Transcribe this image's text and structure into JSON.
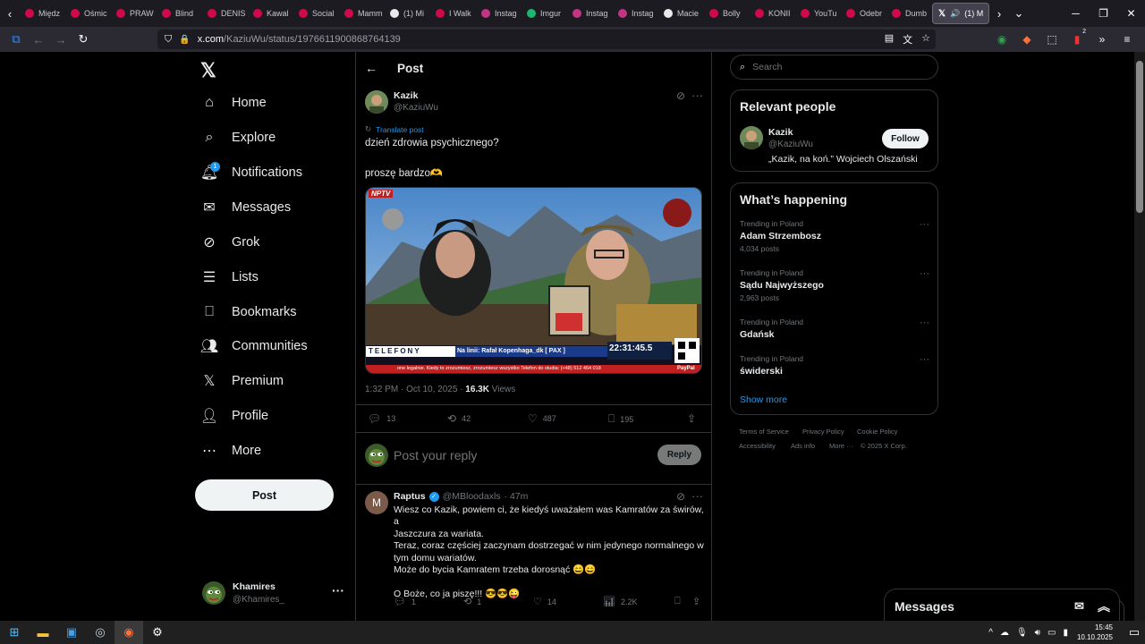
{
  "browser": {
    "tabs": [
      {
        "label": "Międz",
        "color": "#d00a4a"
      },
      {
        "label": "Ośmic",
        "color": "#d00a4a"
      },
      {
        "label": "PRAW",
        "color": "#d00a4a"
      },
      {
        "label": "Blind",
        "color": "#d00a4a"
      },
      {
        "label": "DENIS",
        "color": "#d00a4a"
      },
      {
        "label": "Kawal",
        "color": "#d00a4a"
      },
      {
        "label": "Social",
        "color": "#d00a4a"
      },
      {
        "label": "Mamm",
        "color": "#d00a4a"
      },
      {
        "label": "(1) Mi",
        "color": "#e7e9ea"
      },
      {
        "label": "I Walk",
        "color": "#d00a4a"
      },
      {
        "label": "Instag",
        "color": "#c13584"
      },
      {
        "label": "Imgur",
        "color": "#1bb76e"
      },
      {
        "label": "Instag",
        "color": "#c13584"
      },
      {
        "label": "Instag",
        "color": "#c13584"
      },
      {
        "label": "Macie",
        "color": "#e7e9ea"
      },
      {
        "label": "Bolly",
        "color": "#d00a4a"
      },
      {
        "label": "KONII",
        "color": "#d00a4a"
      },
      {
        "label": "YouTu",
        "color": "#d00a4a"
      },
      {
        "label": "Odebr",
        "color": "#d00a4a"
      },
      {
        "label": "Dumb",
        "color": "#d00a4a"
      }
    ],
    "active_tab": "(1) M",
    "url_host": "x.com",
    "url_path": "/KaziuWu/status/1976611900868764139",
    "extension_badge": "2"
  },
  "sidebar": {
    "items": [
      {
        "label": "Home",
        "icon": "home-icon"
      },
      {
        "label": "Explore",
        "icon": "search-icon"
      },
      {
        "label": "Notifications",
        "icon": "bell-icon",
        "badge": "1"
      },
      {
        "label": "Messages",
        "icon": "envelope-icon"
      },
      {
        "label": "Grok",
        "icon": "grok-icon"
      },
      {
        "label": "Lists",
        "icon": "list-icon"
      },
      {
        "label": "Bookmarks",
        "icon": "bookmark-icon"
      },
      {
        "label": "Communities",
        "icon": "people-icon"
      },
      {
        "label": "Premium",
        "icon": "x-icon"
      },
      {
        "label": "Profile",
        "icon": "person-icon"
      },
      {
        "label": "More",
        "icon": "more-circle-icon"
      }
    ],
    "post_button": "Post",
    "account": {
      "name": "Khamires",
      "handle": "@Khamires_"
    }
  },
  "main": {
    "header_title": "Post",
    "post": {
      "author": "Kazik",
      "handle": "@KaziuWu",
      "translate": "Translate post",
      "text_line1": "dzień zdrowia psychicznego?",
      "text_line2": "proszę bardzo🫶",
      "media": {
        "channel_logo": "NPTV",
        "ticker_top": "TELEFONY",
        "ticker_line": "Na linii: Rafał Kopenhaga_dk [ PAX ]",
        "ticker_bottom": "one legalnie. Kiedy to zrozumiesz, zrozumiesz wszystko  Telefon do studia: (+48) 512 464 018",
        "clock": "22:31:45.5",
        "paypal": "PayPal"
      },
      "time": "1:32 PM · Oct 10, 2025 · ",
      "views_count": "16.3K",
      "views_label": " Views",
      "replies": "13",
      "reposts": "42",
      "likes": "487",
      "bookmarks": "195"
    },
    "reply_placeholder": "Post your reply",
    "reply_button": "Reply",
    "comment": {
      "avatar_letter": "M",
      "author": "Raptus",
      "handle": "@MBloodaxls",
      "time": "· 47m",
      "lines": [
        "Wiesz co Kazik, powiem ci, że kiedyś uważałem was Kamratów za świrów, a",
        "Jaszczura za wariata.",
        "Teraz, coraz częściej zaczynam dostrzegać w nim jedynego normalnego w",
        "tym domu wariatów.",
        "Może do bycia Kamratem trzeba dorosnąć 😄😄",
        "",
        "O Boże, co ja piszę!!! 😎😎😜"
      ],
      "replies": "1",
      "reposts": "1",
      "likes": "14",
      "views": "2.2K"
    }
  },
  "right": {
    "search_placeholder": "Search",
    "relevant_title": "Relevant people",
    "person": {
      "name": "Kazik",
      "handle": "@KaziuWu",
      "bio": "„Kazik, na koń.” Wojciech Olszański",
      "follow": "Follow"
    },
    "happening_title": "What’s happening",
    "trends": [
      {
        "category": "Trending in Poland",
        "name": "Adam Strzembosz",
        "count": "4,034 posts"
      },
      {
        "category": "Trending in Poland",
        "name": "Sądu Najwyższego",
        "count": "2,963 posts"
      },
      {
        "category": "Trending in Poland",
        "name": "Gdańsk",
        "count": ""
      },
      {
        "category": "Trending in Poland",
        "name": "świderski",
        "count": ""
      }
    ],
    "show_more": "Show more",
    "footer": [
      "Terms of Service",
      "Privacy Policy",
      "Cookie Policy",
      "Accessibility",
      "Ads info",
      "More ···",
      "© 2025 X Corp."
    ]
  },
  "messages_dock": {
    "label": "Messages"
  },
  "taskbar": {
    "time": "15:45",
    "date": "10.10.2025"
  },
  "colors": {
    "accent": "#1d9bf0",
    "background": "#000000",
    "border": "#2f3336",
    "muted": "#71767b"
  }
}
